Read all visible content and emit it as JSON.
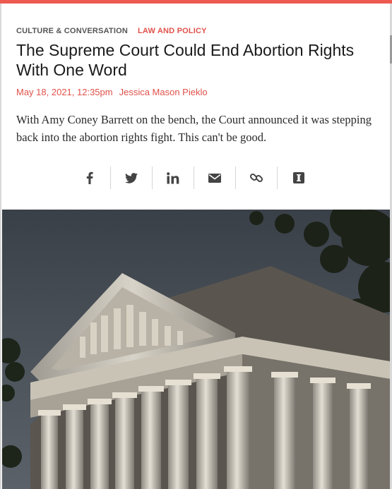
{
  "accent_color": "#e0514a",
  "article": {
    "categories": [
      "CULTURE & CONVERSATION",
      "LAW AND POLICY"
    ],
    "title": "The Supreme Court Could End Abortion Rights With One Word",
    "date": "May 18, 2021, 12:35pm",
    "author": "Jessica Mason Pieklo",
    "dek": "With Amy Coney Barrett on the bench, the Court announced it was stepping back into the abortion rights fight. This can't be good."
  },
  "share": {
    "icons": [
      "facebook-icon",
      "twitter-icon",
      "linkedin-icon",
      "email-icon",
      "link-icon",
      "instapaper-icon"
    ]
  },
  "hero_image": {
    "subject": "supreme-court-building"
  }
}
